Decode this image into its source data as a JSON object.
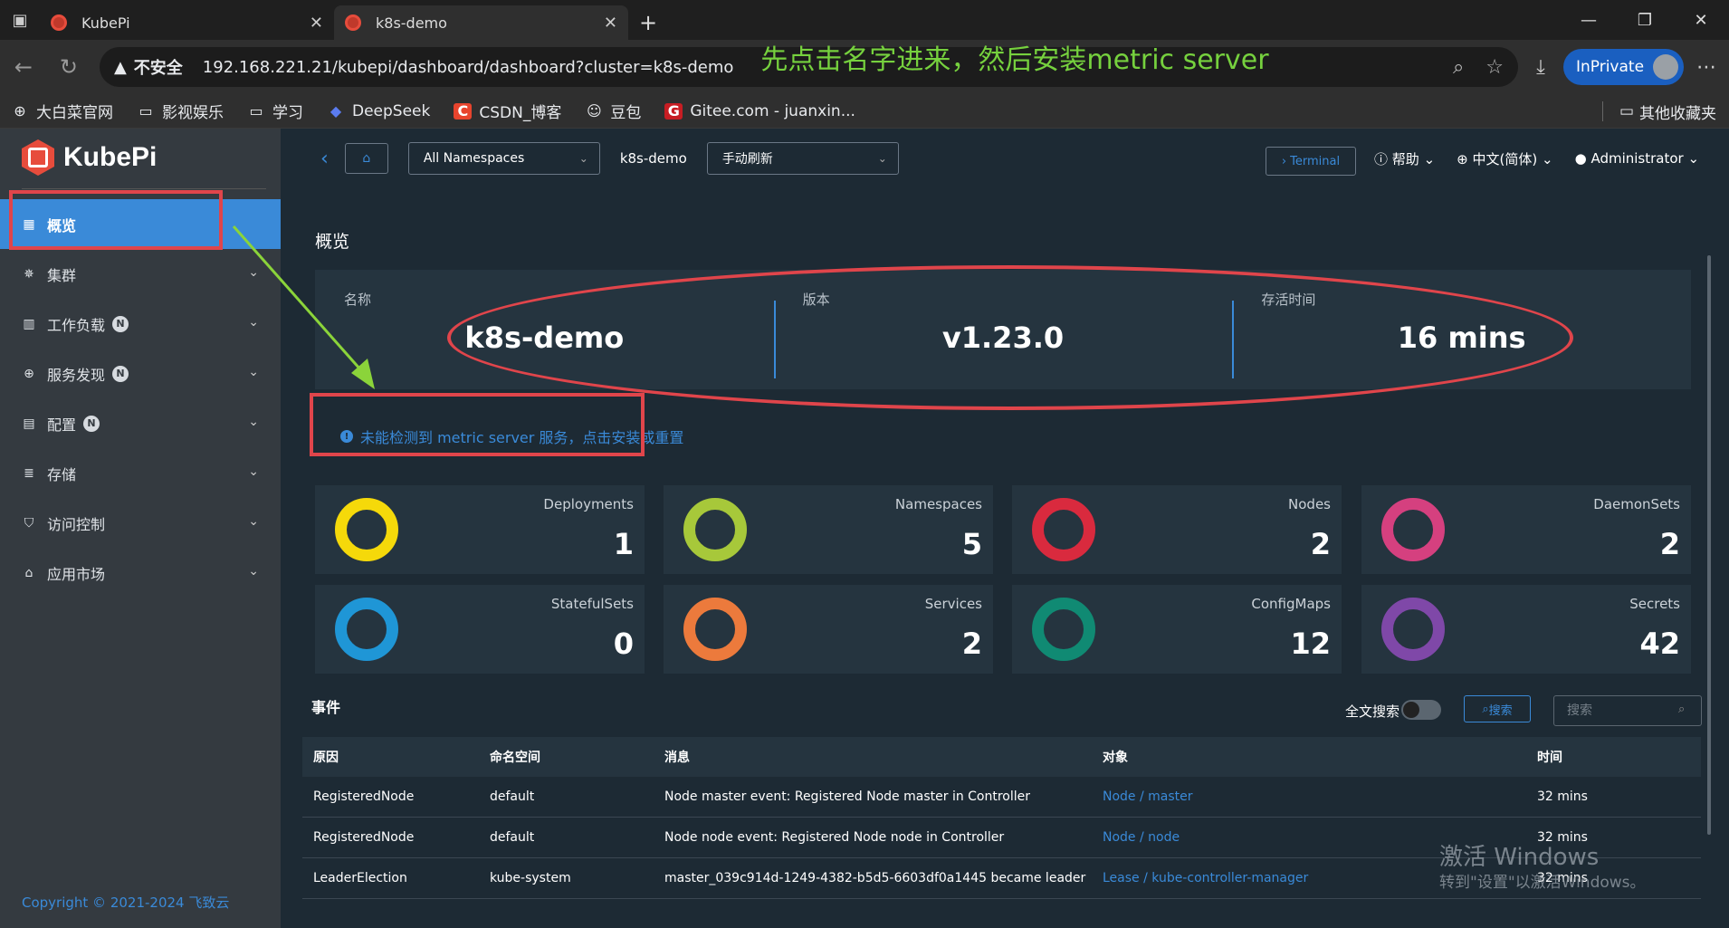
{
  "browser": {
    "tabs": [
      {
        "title": "KubePi",
        "active": false
      },
      {
        "title": "k8s-demo",
        "active": true
      }
    ],
    "address": {
      "security": "不安全",
      "url": "192.168.221.21/kubepi/dashboard/dashboard?cluster=k8s-demo"
    },
    "annotation": "先点击名字进来，然后安装metric server",
    "inprivate": "InPrivate",
    "bookmarks": [
      "大白菜官网",
      "影视娱乐",
      "学习",
      "DeepSeek",
      "CSDN_博客",
      "豆包",
      "Gitee.com - juanxin..."
    ],
    "other_bookmarks": "其他收藏夹"
  },
  "app": {
    "logo": "KubePi",
    "sidebar": [
      {
        "label": "概览",
        "icon": "dashboard-icon",
        "active": true,
        "badge": "",
        "chevron": false
      },
      {
        "label": "集群",
        "icon": "helm-icon",
        "active": false,
        "badge": "",
        "chevron": true
      },
      {
        "label": "工作负载",
        "icon": "workload-icon",
        "active": false,
        "badge": "N",
        "chevron": true
      },
      {
        "label": "服务发现",
        "icon": "globe-icon",
        "active": false,
        "badge": "N",
        "chevron": true
      },
      {
        "label": "配置",
        "icon": "config-icon",
        "active": false,
        "badge": "N",
        "chevron": true
      },
      {
        "label": "存储",
        "icon": "database-icon",
        "active": false,
        "badge": "",
        "chevron": true
      },
      {
        "label": "访问控制",
        "icon": "shield-icon",
        "active": false,
        "badge": "",
        "chevron": true
      },
      {
        "label": "应用市场",
        "icon": "bag-icon",
        "active": false,
        "badge": "",
        "chevron": true
      }
    ],
    "copyright": "Copyright © 2021-2024 飞致云",
    "topnav": {
      "namespace": "All Namespaces",
      "cluster": "k8s-demo",
      "refresh": "手动刷新",
      "terminal": "Terminal",
      "help": "帮助",
      "language": "中文(简体)",
      "user": "Administrator"
    },
    "overview": {
      "title": "概览",
      "summary": [
        {
          "label": "名称",
          "value": "k8s-demo"
        },
        {
          "label": "版本",
          "value": "v1.23.0"
        },
        {
          "label": "存活时间",
          "value": "16 mins"
        }
      ],
      "alert": "未能检测到 metric server 服务，点击安装或重置",
      "cards": [
        {
          "label": "Deployments",
          "value": "1",
          "color": "#f5d90a"
        },
        {
          "label": "Namespaces",
          "value": "5",
          "color": "#a7c83a"
        },
        {
          "label": "Nodes",
          "value": "2",
          "color": "#d92a3e"
        },
        {
          "label": "DaemonSets",
          "value": "2",
          "color": "#d5407f"
        },
        {
          "label": "StatefulSets",
          "value": "0",
          "color": "#1f96d6"
        },
        {
          "label": "Services",
          "value": "2",
          "color": "#ec7a3c"
        },
        {
          "label": "ConfigMaps",
          "value": "12",
          "color": "#108a73"
        },
        {
          "label": "Secrets",
          "value": "42",
          "color": "#7f48a8"
        }
      ]
    },
    "events": {
      "title": "事件",
      "fulltext_label": "全文搜索",
      "search_button": "搜索",
      "search_placeholder": "搜索",
      "columns": [
        "原因",
        "命名空间",
        "消息",
        "对象",
        "时间"
      ],
      "rows": [
        [
          "RegisteredNode",
          "default",
          "Node master event: Registered Node master in Controller",
          "Node / master",
          "32 mins"
        ],
        [
          "RegisteredNode",
          "default",
          "Node node event: Registered Node node in Controller",
          "Node / node",
          "32 mins"
        ],
        [
          "LeaderElection",
          "kube-system",
          "master_039c914d-1249-4382-b5d5-6603df0a1445 became leader",
          "Lease / kube-controller-manager",
          "32 mins"
        ]
      ]
    }
  },
  "watermark": {
    "line1": "激活 Windows",
    "line2": "转到\"设置\"以激活Windows。"
  }
}
